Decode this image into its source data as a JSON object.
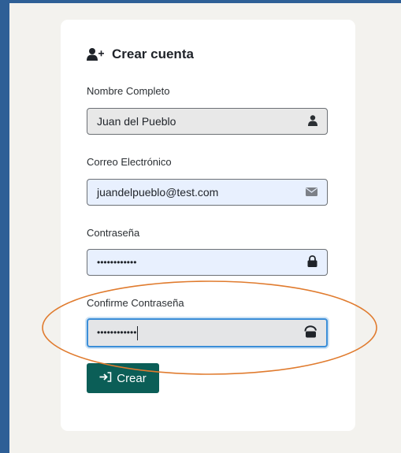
{
  "form": {
    "title": "Crear cuenta",
    "fields": [
      {
        "label": "Nombre Completo",
        "value": "Juan del Pueblo",
        "icon": "user-icon"
      },
      {
        "label": "Correo Electrónico",
        "value": "juandelpueblo@test.com",
        "icon": "envelope-icon"
      },
      {
        "label": "Contraseña",
        "value": "••••••••••••",
        "icon": "lock-icon"
      },
      {
        "label": "Confirme Contraseña",
        "value": "••••••••••••",
        "icon": "unlock-icon"
      }
    ],
    "submit_label": "Crear"
  },
  "colors": {
    "frame": "#2e5f96",
    "button": "#0b5e57",
    "annotation": "#e07b2e",
    "focus": "#3b8ed8"
  }
}
